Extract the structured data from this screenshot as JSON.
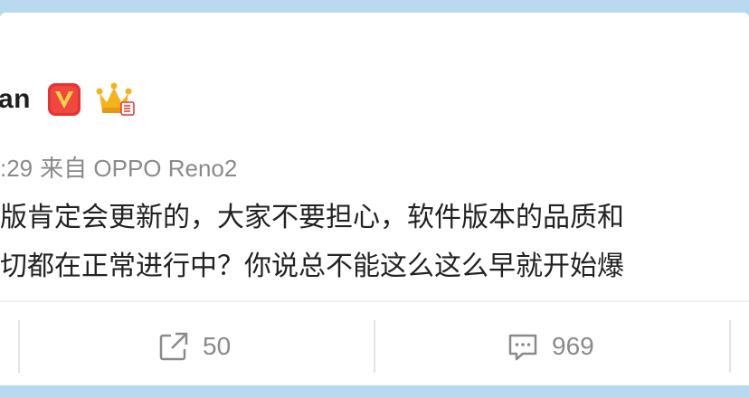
{
  "post": {
    "author_name": "an",
    "meta_time": ":29",
    "meta_source": "来自 OPPO Reno2",
    "content_line1": "版肯定会更新的，大家不要担心，软件版本的品质和",
    "content_line2": "切都在正常进行中？你说总不能这么这么早就开始爆",
    "badges": [
      "verified-v-icon",
      "crown-level-icon"
    ]
  },
  "actions": {
    "repost_count": "50",
    "comment_count": "969"
  },
  "colors": {
    "background": "#b9d9ee",
    "card": "#ffffff",
    "text_primary": "#1f1f1f",
    "text_meta": "#8a8a8a",
    "v_badge": "#e8322d",
    "crown": "#f6b21d"
  }
}
